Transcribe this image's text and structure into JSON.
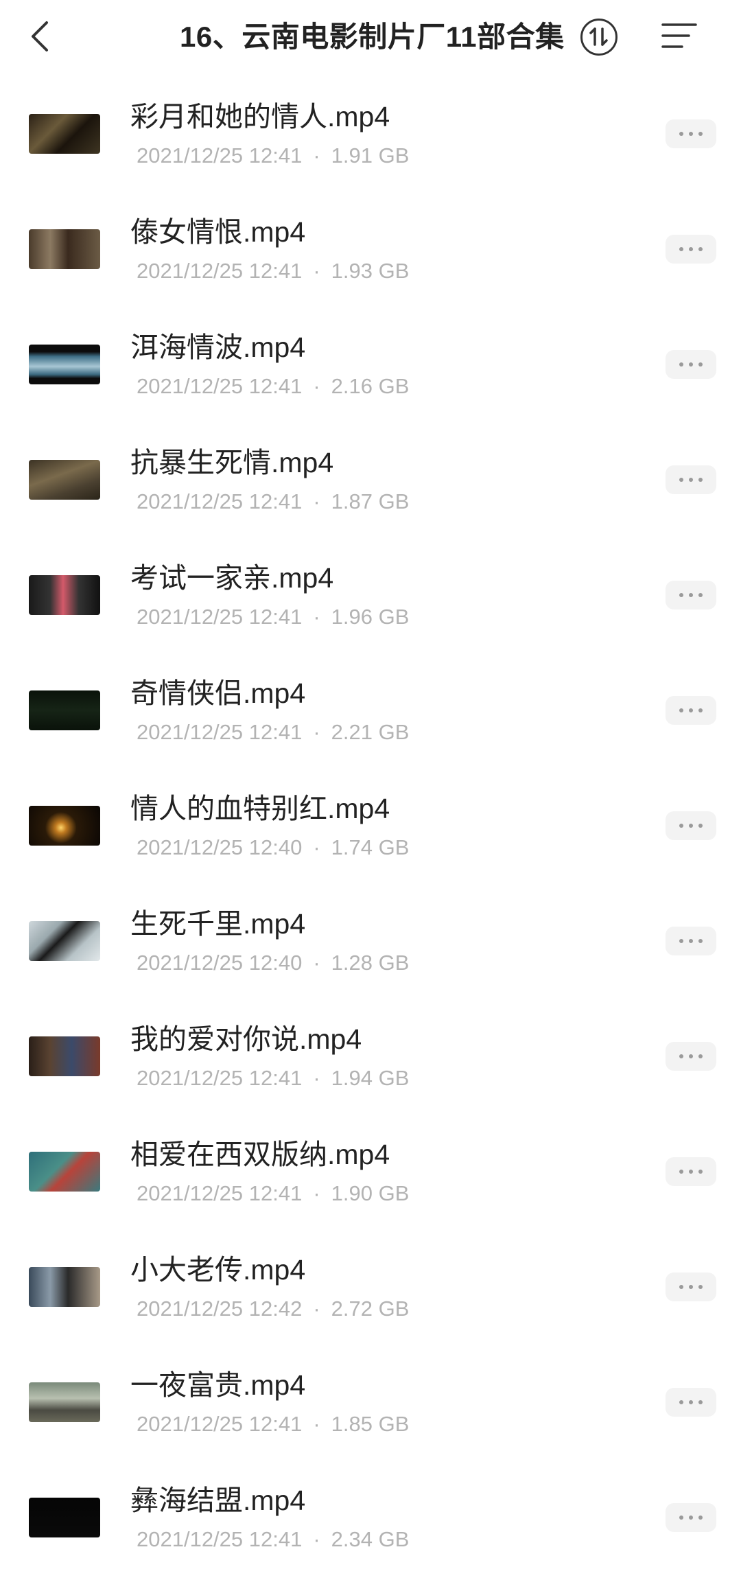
{
  "header": {
    "title": "16、云南电影制片厂11部合集"
  },
  "files": [
    {
      "name": "彩月和她的情人.mp4",
      "date": "2021/12/25 12:41",
      "size": "1.91 GB",
      "thumb": "linear-gradient(135deg,#2b2116 0%,#6a5a3a 35%,#1b140c 60%,#3e3522 100%)"
    },
    {
      "name": "傣女情恨.mp4",
      "date": "2021/12/25 12:41",
      "size": "1.93 GB",
      "thumb": "linear-gradient(90deg,#4a3b2b 0%,#8c7a62 30%,#3a2a1e 55%,#6b5b45 100%)"
    },
    {
      "name": "洱海情波.mp4",
      "date": "2021/12/25 12:41",
      "size": "2.16 GB",
      "thumb": "linear-gradient(180deg,#0c0c0c 0%,#0c0c0c 18%,#3f6f86 30%,#a8c7d4 55%,#3c6a80 75%,#0c0c0c 85%)"
    },
    {
      "name": "抗暴生死情.mp4",
      "date": "2021/12/25 12:41",
      "size": "1.87 GB",
      "thumb": "linear-gradient(160deg,#3b3224 0%,#7a6a4c 40%,#4a4030 70%,#2a2418 100%)"
    },
    {
      "name": "考试一家亲.mp4",
      "date": "2021/12/25 12:41",
      "size": "1.96 GB",
      "thumb": "linear-gradient(90deg,#1a1a1a 0%,#333 30%,#d45a6a 48%,#333 70%,#111 100%)"
    },
    {
      "name": "奇情侠侣.mp4",
      "date": "2021/12/25 12:41",
      "size": "2.21 GB",
      "thumb": "linear-gradient(180deg,#0a120a 0%,#162416 50%,#0a120a 100%)"
    },
    {
      "name": "情人的血特别红.mp4",
      "date": "2021/12/25 12:40",
      "size": "1.74 GB",
      "thumb": "radial-gradient(circle at 45% 55%,#ffd56a 0%,#c07a20 12%,#2a1a08 35%,#0a0604 100%)"
    },
    {
      "name": "生死千里.mp4",
      "date": "2021/12/25 12:40",
      "size": "1.28 GB",
      "thumb": "linear-gradient(135deg,#cfd8dc 0%,#9aa8ad 30%,#1a1a1a 45%,#b7c3c7 70%,#e2e8ea 100%)"
    },
    {
      "name": "我的爱对你说.mp4",
      "date": "2021/12/25 12:41",
      "size": "1.94 GB",
      "thumb": "linear-gradient(90deg,#2a1f18 0%,#5a4332 30%,#3b4a6a 60%,#7a3a2a 100%)"
    },
    {
      "name": "相爱在西双版纳.mp4",
      "date": "2021/12/25 12:41",
      "size": "1.90 GB",
      "thumb": "linear-gradient(135deg,#2f6f7a 0%,#4a8f88 40%,#b8433a 55%,#3a7a7e 100%)"
    },
    {
      "name": "小大老传.mp4",
      "date": "2021/12/25 12:42",
      "size": "2.72 GB",
      "thumb": "linear-gradient(90deg,#3a4a5a 0%,#8a9aa8 30%,#2a2a2a 55%,#a89a88 100%)"
    },
    {
      "name": "一夜富贵.mp4",
      "date": "2021/12/25 12:41",
      "size": "1.85 GB",
      "thumb": "linear-gradient(180deg,#7a8a7a 0%,#b8c0b0 40%,#4a4a42 70%,#6a6a5a 100%)"
    },
    {
      "name": "彝海结盟.mp4",
      "date": "2021/12/25 12:41",
      "size": "2.34 GB",
      "thumb": "linear-gradient(180deg,#050505 0%,#0a0a0a 100%)"
    }
  ]
}
